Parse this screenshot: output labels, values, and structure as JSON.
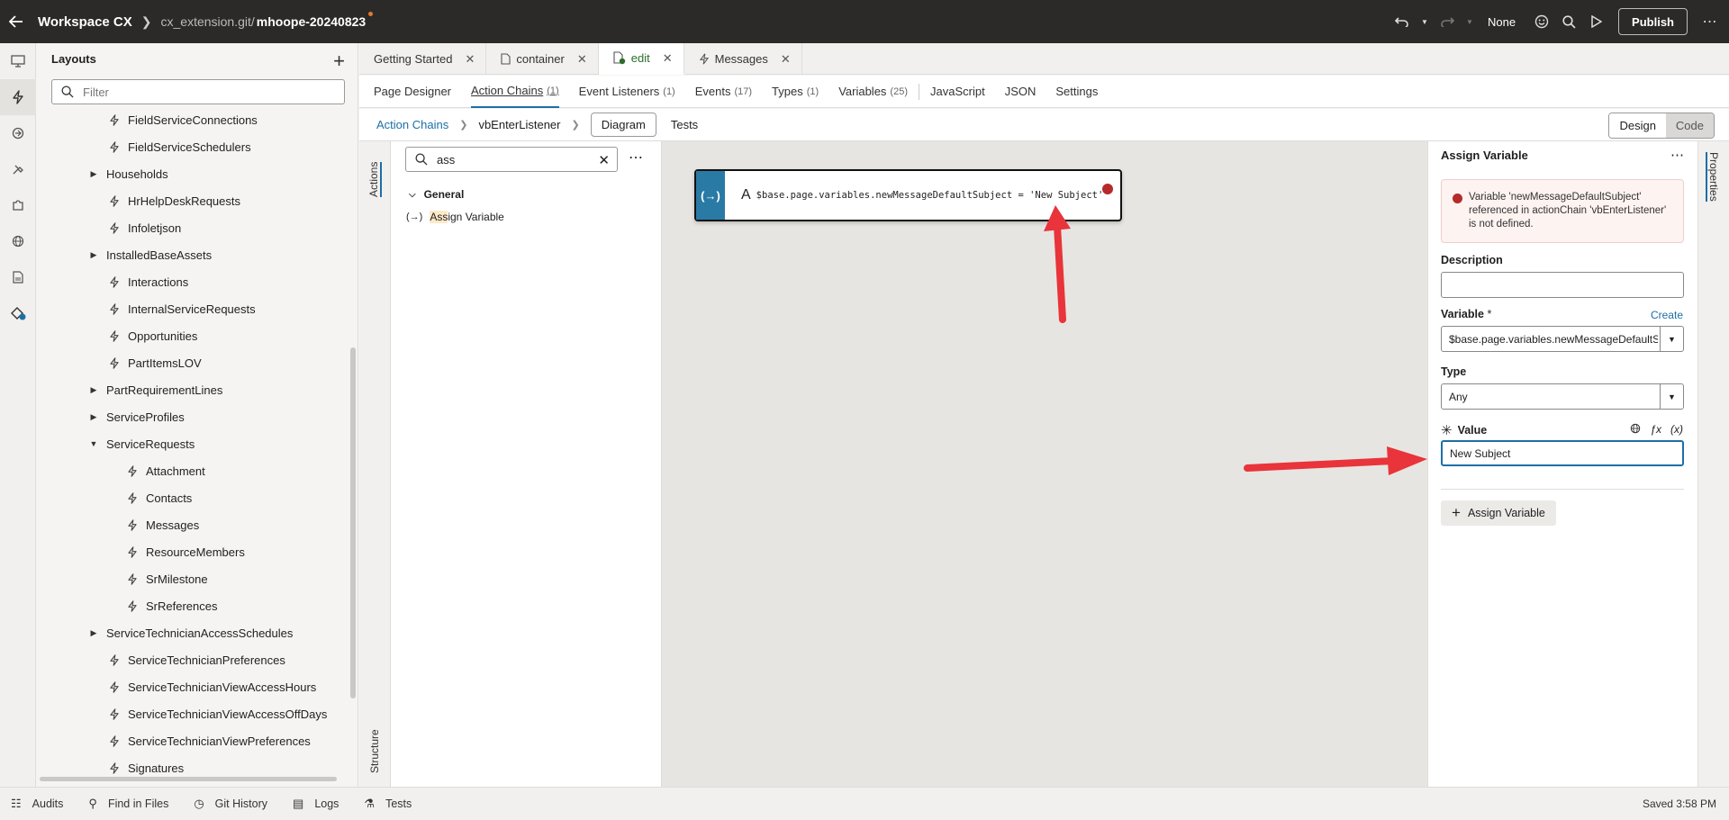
{
  "topbar": {
    "app_title": "Workspace CX",
    "repo": "cx_extension.git/",
    "branch": "mhoope-20240823",
    "profile": "None",
    "publish": "Publish"
  },
  "navigator": {
    "title": "Layouts",
    "filter_placeholder": "Filter",
    "items": [
      {
        "label": "FieldServiceConnections",
        "expandable": false,
        "expanded": false,
        "depth": 0
      },
      {
        "label": "FieldServiceSchedulers",
        "expandable": false,
        "expanded": false,
        "depth": 0
      },
      {
        "label": "Households",
        "expandable": true,
        "expanded": false,
        "depth": 0
      },
      {
        "label": "HrHelpDeskRequests",
        "expandable": false,
        "expanded": false,
        "depth": 0
      },
      {
        "label": "Infoletjson",
        "expandable": false,
        "expanded": false,
        "depth": 0
      },
      {
        "label": "InstalledBaseAssets",
        "expandable": true,
        "expanded": false,
        "depth": 0
      },
      {
        "label": "Interactions",
        "expandable": false,
        "expanded": false,
        "depth": 0
      },
      {
        "label": "InternalServiceRequests",
        "expandable": false,
        "expanded": false,
        "depth": 0
      },
      {
        "label": "Opportunities",
        "expandable": false,
        "expanded": false,
        "depth": 0
      },
      {
        "label": "PartItemsLOV",
        "expandable": false,
        "expanded": false,
        "depth": 0
      },
      {
        "label": "PartRequirementLines",
        "expandable": true,
        "expanded": false,
        "depth": 0
      },
      {
        "label": "ServiceProfiles",
        "expandable": true,
        "expanded": false,
        "depth": 0
      },
      {
        "label": "ServiceRequests",
        "expandable": true,
        "expanded": true,
        "depth": 0
      },
      {
        "label": "Attachment",
        "expandable": false,
        "expanded": false,
        "depth": 1
      },
      {
        "label": "Contacts",
        "expandable": false,
        "expanded": false,
        "depth": 1
      },
      {
        "label": "Messages",
        "expandable": false,
        "expanded": false,
        "depth": 1
      },
      {
        "label": "ResourceMembers",
        "expandable": false,
        "expanded": false,
        "depth": 1
      },
      {
        "label": "SrMilestone",
        "expandable": false,
        "expanded": false,
        "depth": 1
      },
      {
        "label": "SrReferences",
        "expandable": false,
        "expanded": false,
        "depth": 1
      },
      {
        "label": "ServiceTechnicianAccessSchedules",
        "expandable": true,
        "expanded": false,
        "depth": 0
      },
      {
        "label": "ServiceTechnicianPreferences",
        "expandable": false,
        "expanded": false,
        "depth": 0
      },
      {
        "label": "ServiceTechnicianViewAccessHours",
        "expandable": false,
        "expanded": false,
        "depth": 0
      },
      {
        "label": "ServiceTechnicianViewAccessOffDays",
        "expandable": false,
        "expanded": false,
        "depth": 0
      },
      {
        "label": "ServiceTechnicianViewPreferences",
        "expandable": false,
        "expanded": false,
        "depth": 0
      },
      {
        "label": "Signatures",
        "expandable": false,
        "expanded": false,
        "depth": 0
      }
    ]
  },
  "editor_tabs": [
    {
      "label": "Getting Started",
      "icon": "none",
      "active": false
    },
    {
      "label": "container",
      "icon": "file-icon",
      "active": false
    },
    {
      "label": "edit",
      "icon": "file-edit-icon",
      "active": true
    },
    {
      "label": "Messages",
      "icon": "bolt-icon",
      "active": false
    }
  ],
  "sub_tabs": [
    {
      "label": "Page Designer",
      "count": ""
    },
    {
      "label": "Action Chains",
      "count": "(1)"
    },
    {
      "label": "Event Listeners",
      "count": "(1)"
    },
    {
      "label": "Events",
      "count": "(17)"
    },
    {
      "label": "Types",
      "count": "(1)"
    },
    {
      "label": "Variables",
      "count": "(25)"
    },
    {
      "label": "JavaScript",
      "count": ""
    },
    {
      "label": "JSON",
      "count": ""
    },
    {
      "label": "Settings",
      "count": ""
    }
  ],
  "breadcrumb": {
    "root": "Action Chains",
    "current": "vbEnterListener",
    "diagram": "Diagram",
    "tests": "Tests",
    "design": "Design",
    "code": "Code"
  },
  "side_tabs": {
    "actions": "Actions",
    "structure": "Structure",
    "properties": "Properties"
  },
  "actions_panel": {
    "search_value": "ass",
    "group": "General",
    "item_prefix": "Ass",
    "item_rest": "ign Variable"
  },
  "canvas": {
    "node_symbol": "(→)",
    "node_expression": "$base.page.variables.newMessageDefaultSubject = 'New Subject'"
  },
  "properties": {
    "title": "Assign Variable",
    "error_message": "Variable 'newMessageDefaultSubject' referenced in actionChain 'vbEnterListener' is not defined.",
    "description_label": "Description",
    "description_value": "",
    "variable_label": "Variable",
    "variable_required": "*",
    "create_link": "Create",
    "variable_value": "$base.page.variables.newMessageDefaultSubject",
    "type_label": "Type",
    "type_value": "Any",
    "value_label": "Value",
    "value_value": "New Subject",
    "add_button": "Assign Variable"
  },
  "statusbar": {
    "items": [
      "Audits",
      "Find in Files",
      "Git History",
      "Logs",
      "Tests"
    ],
    "saved": "Saved 3:58 PM"
  },
  "colors": {
    "topbar": "#2b2a28",
    "accent": "#1d6fa5",
    "node_strip": "#2a7aa6",
    "error": "#b52b2b",
    "arrow": "#e8343a"
  }
}
